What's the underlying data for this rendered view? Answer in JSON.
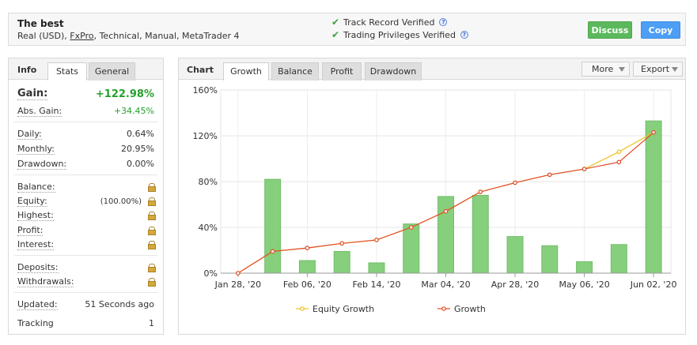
{
  "header": {
    "title": "The best",
    "subtitle_prefix": "Real (USD), ",
    "broker": "FxPro",
    "subtitle_suffix": ", Technical, Manual, MetaTrader 4",
    "track_record": "Track Record Verified",
    "trading_privileges": "Trading Privileges Verified",
    "question_mark": "?",
    "discuss_label": "Discuss",
    "copy_label": "Copy"
  },
  "info": {
    "tab_title": "Info",
    "tabs": [
      "Stats",
      "General"
    ],
    "gain": {
      "label": "Gain:",
      "value": "+122.98%"
    },
    "abs_gain": {
      "label": "Abs. Gain:",
      "value": "+34.45%"
    },
    "daily": {
      "label": "Daily:",
      "value": "0.64%"
    },
    "monthly": {
      "label": "Monthly:",
      "value": "20.95%"
    },
    "drawdown": {
      "label": "Drawdown:",
      "value": "0.00%"
    },
    "balance": {
      "label": "Balance:"
    },
    "equity": {
      "label": "Equity:",
      "pct": "(100.00%)"
    },
    "highest": {
      "label": "Highest:"
    },
    "profit": {
      "label": "Profit:"
    },
    "interest": {
      "label": "Interest:"
    },
    "deposits": {
      "label": "Deposits:"
    },
    "withdrawals": {
      "label": "Withdrawals:"
    },
    "updated": {
      "label": "Updated:",
      "value": "51 Seconds ago"
    },
    "tracking": {
      "label": "Tracking",
      "value": "1"
    },
    "lock_icon": "lock-icon"
  },
  "chart": {
    "tab_title": "Chart",
    "tabs": [
      "Growth",
      "Balance",
      "Profit",
      "Drawdown"
    ],
    "more_label": "More",
    "export_label": "Export"
  },
  "chart_data": {
    "type": "bar+line",
    "title": "",
    "xlabel": "",
    "ylabel": "",
    "ylim": [
      0,
      160
    ],
    "y_ticks": [
      "0%",
      "40%",
      "80%",
      "120%",
      "160%"
    ],
    "y_tick_values": [
      0,
      40,
      80,
      120,
      160
    ],
    "x_tick_labels": [
      "Jan 28, '20",
      "Feb 06, '20",
      "Feb 14, '20",
      "Mar 04, '20",
      "Apr 28, '20",
      "May 06, '20",
      "Jun 02, '20"
    ],
    "x_tick_index": [
      0,
      2,
      4,
      6,
      8,
      10,
      12
    ],
    "bars": [
      0,
      82,
      11,
      19,
      9,
      43,
      67,
      68,
      32,
      24,
      10,
      25,
      133
    ],
    "series": [
      {
        "name": "Equity Growth",
        "color": "#f0c020",
        "values": [
          0,
          19,
          22,
          26,
          29,
          40,
          54,
          71,
          79,
          86,
          91,
          106,
          122.98
        ]
      },
      {
        "name": "Growth",
        "color": "#e0492a",
        "values": [
          0,
          19,
          22,
          26,
          29,
          40,
          54,
          71,
          79,
          86,
          91,
          97,
          122.98
        ]
      }
    ],
    "bar_color": "#86cf7c",
    "grid": true,
    "legend_position": "bottom"
  }
}
